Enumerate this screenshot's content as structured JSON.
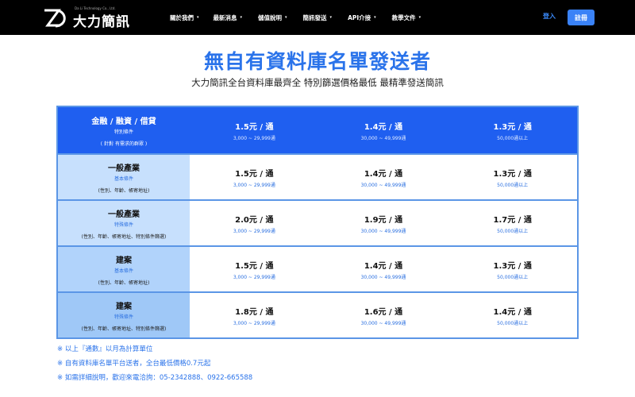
{
  "navbar": {
    "logo_text": "大力簡訊",
    "logo_sub": "Da Li Technology Co., Ltd.",
    "menu": [
      {
        "label": "關於我們"
      },
      {
        "label": "最新消息"
      },
      {
        "label": "儲值說明"
      },
      {
        "label": "簡訊發送"
      },
      {
        "label": "API介接"
      },
      {
        "label": "教學文件"
      }
    ],
    "login_label": "登入",
    "register_label": "註冊"
  },
  "page": {
    "title": "無自有資料庫名單發送者",
    "subtitle": "大力簡訊全台資料庫最齊全 特別篩選價格最低 最精準發送簡訊"
  },
  "pricing": {
    "rows": [
      {
        "name": "金融 / 融資 / 借貸",
        "type": "特別條件",
        "note": "( 針對 有需求的群眾 )",
        "prices": [
          {
            "price": "1.5元 / 通",
            "range": "3,000 ~ 29,999通"
          },
          {
            "price": "1.4元 / 通",
            "range": "30,000 ~ 49,999通"
          },
          {
            "price": "1.3元 / 通",
            "range": "50,000通以上"
          }
        ]
      },
      {
        "name": "一般產業",
        "type": "基本條件",
        "note": "(性別、年齡、帳寄地址)",
        "prices": [
          {
            "price": "1.5元 / 通",
            "range": "3,000 ~ 29,999通"
          },
          {
            "price": "1.4元 / 通",
            "range": "30,000 ~ 49,999通"
          },
          {
            "price": "1.3元 / 通",
            "range": "50,000通以上"
          }
        ]
      },
      {
        "name": "一般產業",
        "type": "特殊條件",
        "note": "(性別、年齡、帳寄地址、特別條件篩選)",
        "prices": [
          {
            "price": "2.0元 / 通",
            "range": "3,000 ~ 29,999通"
          },
          {
            "price": "1.9元 / 通",
            "range": "30,000 ~ 49,999通"
          },
          {
            "price": "1.7元 / 通",
            "range": "50,000通以上"
          }
        ]
      },
      {
        "name": "建案",
        "type": "基本條件",
        "note": "(性別、年齡、帳寄地址)",
        "prices": [
          {
            "price": "1.5元 / 通",
            "range": "3,000 ~ 29,999通"
          },
          {
            "price": "1.4元 / 通",
            "range": "30,000 ~ 49,999通"
          },
          {
            "price": "1.3元 / 通",
            "range": "50,000通以上"
          }
        ]
      },
      {
        "name": "建案",
        "type": "特殊條件",
        "note": "(性別、年齡、帳寄地址、特別條件篩選)",
        "prices": [
          {
            "price": "1.8元 / 通",
            "range": "3,000 ~ 29,999通"
          },
          {
            "price": "1.6元 / 通",
            "range": "30,000 ~ 49,999通"
          },
          {
            "price": "1.4元 / 通",
            "range": "50,000通以上"
          }
        ]
      }
    ]
  },
  "notes": [
    "※ 以上『通數』以月為計算單位",
    "※ 自有資料庫名單平台送者，全台最低價格0.7元起",
    "※ 如需詳細說明，歡迎來電洽詢：05-2342888、0922-665588"
  ],
  "colors": {
    "accent": "#2a73ea",
    "header_row": "#1f5ff0",
    "navbar": "#000000"
  }
}
